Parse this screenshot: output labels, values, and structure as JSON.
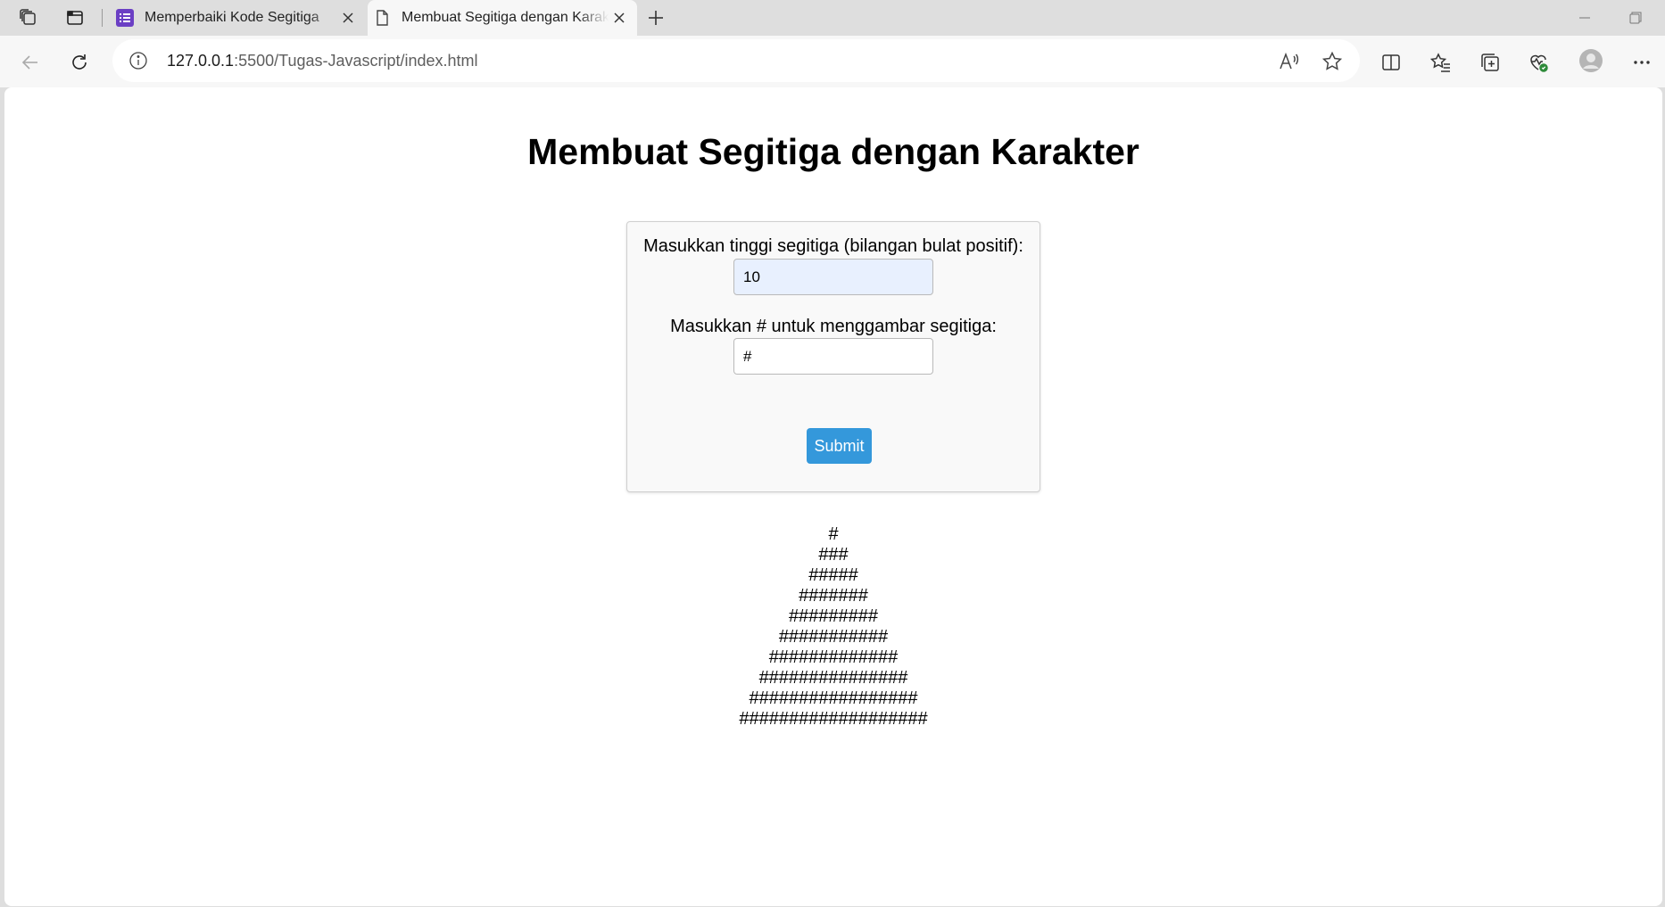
{
  "browser": {
    "tabs": [
      {
        "title": "Memperbaiki Kode Segitiga",
        "favicon": "forms-list-icon",
        "active": false
      },
      {
        "title": "Membuat Segitiga dengan Karakter",
        "favicon": "page-icon",
        "active": true
      }
    ],
    "address": {
      "host": "127.0.0.1",
      "path": ":5500/Tugas-Javascript/index.html"
    }
  },
  "page": {
    "title": "Membuat Segitiga dengan Karakter",
    "form": {
      "height_label": "Masukkan tinggi segitiga (bilangan bulat positif):",
      "height_value": "10",
      "char_label": "Masukkan # untuk menggambar segitiga:",
      "char_value": "#",
      "submit_label": "Submit"
    },
    "triangle_rows": [
      "#",
      "###",
      "#####",
      "#######",
      "#########",
      "###########",
      "#############",
      "###############",
      "#################",
      "###################"
    ]
  },
  "colors": {
    "submit_button": "#3498db",
    "autofill_input": "#e8f0fe",
    "tab_favicon_purple": "#6b3fc4"
  }
}
